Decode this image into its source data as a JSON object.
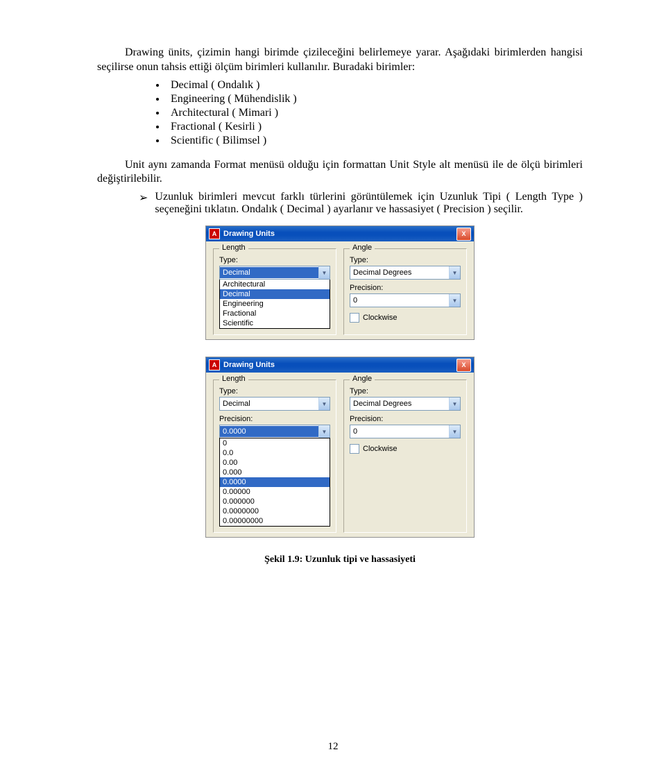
{
  "para1": "Drawing ünits, çizimin hangi birimde çizileceğini belirlemeye yarar. Aşağıdaki birimlerden hangisi seçilirse onun tahsis ettiği ölçüm birimleri kullanılır. Buradaki birimler:",
  "bullets": [
    "Decimal ( Ondalık )",
    "Engineering ( Mühendislik )",
    "Architectural ( Mimari )",
    "Fractional ( Kesirli )",
    "Scientific ( Bilimsel )"
  ],
  "para2": "Unit aynı zamanda Format menüsü olduğu için formattan Unit Style alt menüsü ile de ölçü birimleri değiştirilebilir.",
  "arrow_item": "Uzunluk birimleri mevcut farklı türlerini görüntülemek için Uzunluk Tipi ( Length Type ) seçeneğini tıklatın. Ondalık ( Decimal ) ayarlanır ve hassasiyet ( Precision ) seçilir.",
  "dialog": {
    "title": "Drawing Units",
    "icon_text": "A",
    "close": "X",
    "length": {
      "group": "Length",
      "type_label": "Type:",
      "type_value": "Decimal",
      "precision_label": "Precision:",
      "precision_value": "0.0000",
      "type_options": [
        "Architectural",
        "Decimal",
        "Engineering",
        "Fractional",
        "Scientific"
      ],
      "precision_options": [
        "0",
        "0.0",
        "0.00",
        "0.000",
        "0.0000",
        "0.00000",
        "0.000000",
        "0.0000000",
        "0.00000000"
      ]
    },
    "angle": {
      "group": "Angle",
      "type_label": "Type:",
      "type_value": "Decimal Degrees",
      "precision_label": "Precision:",
      "precision_value": "0",
      "clockwise": "Clockwise"
    }
  },
  "caption": "Şekil 1.9: Uzunluk tipi ve hassasiyeti",
  "page_number": "12"
}
